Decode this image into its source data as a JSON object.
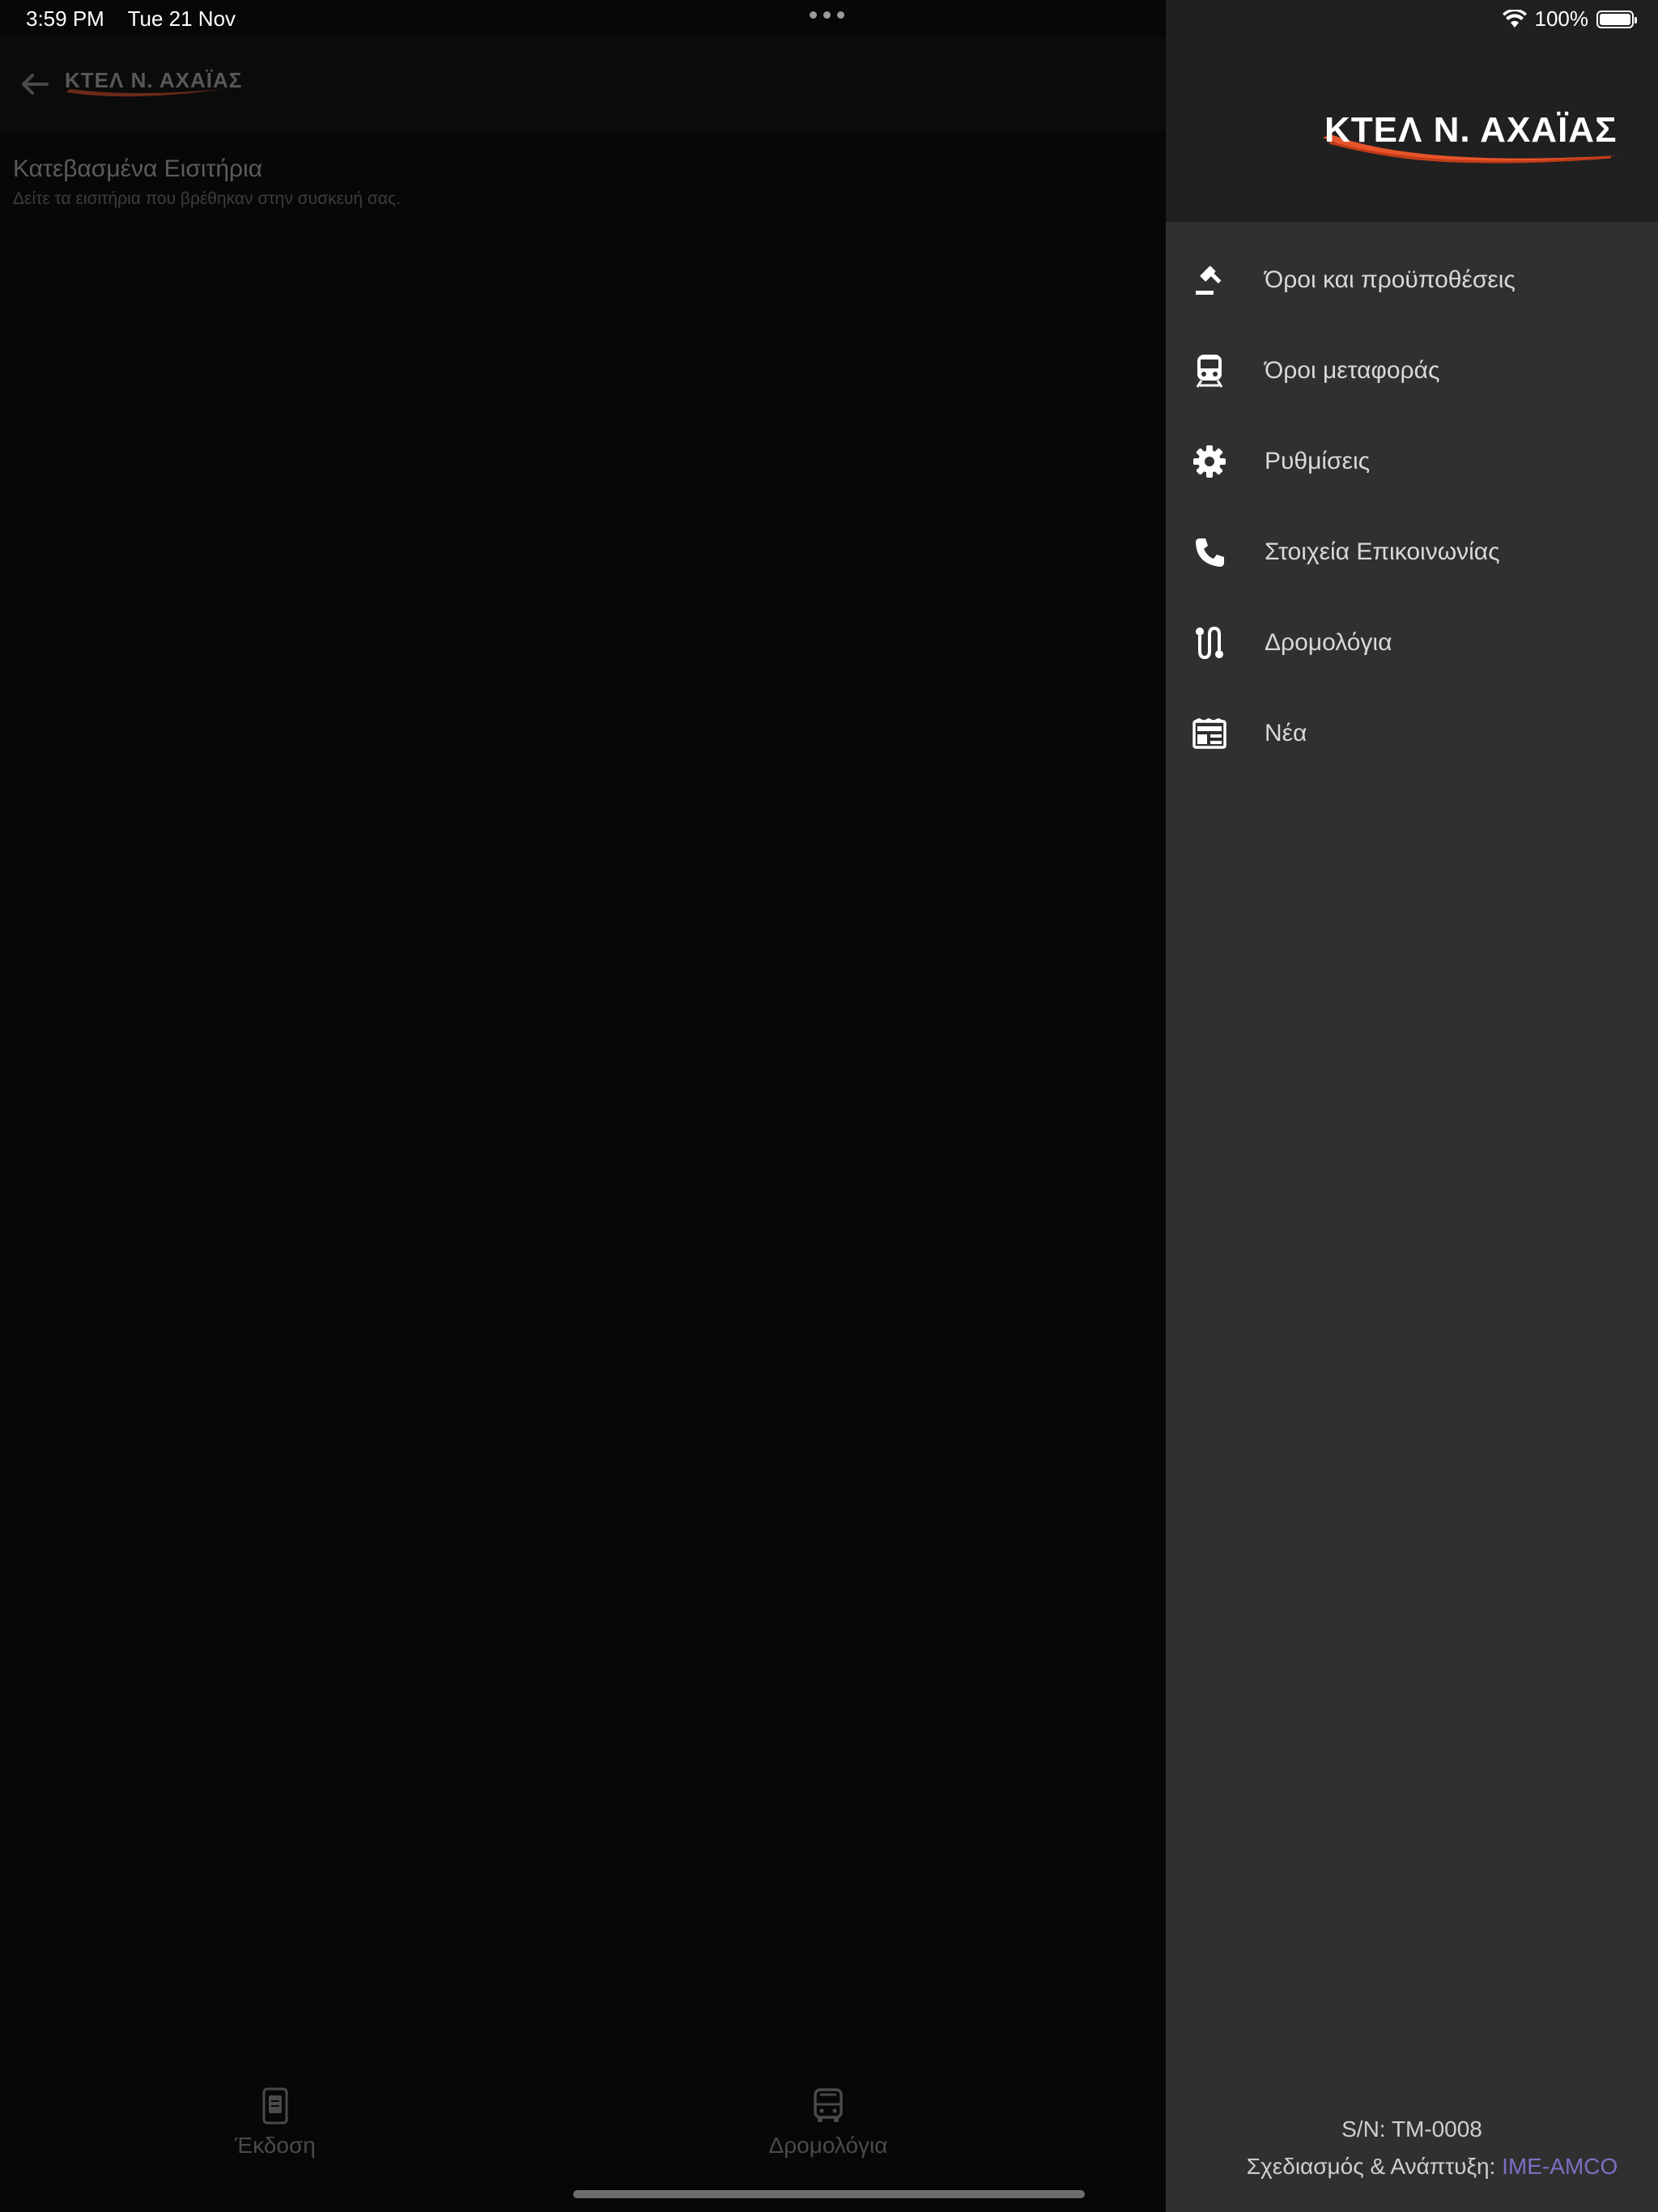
{
  "status_bar": {
    "time": "3:59 PM",
    "date": "Tue 21 Nov",
    "battery": "100%"
  },
  "brand": {
    "logo_text": "ΚΤΕΛ Ν. ΑΧΑΪΑΣ",
    "accent": "#e8542a"
  },
  "page": {
    "title": "Κατεβασμένα Εισιτήρια",
    "subtitle": "Δείτε τα εισιτήρια που βρέθηκαν στην συσκευή σας."
  },
  "bottom_nav": [
    {
      "label": "Έκδοση",
      "icon": "ticket-phone-icon"
    },
    {
      "label": "Δρομολόγια",
      "icon": "bus-icon"
    }
  ],
  "drawer": {
    "menu": [
      {
        "label": "Όροι και προϋποθέσεις",
        "icon": "gavel-icon"
      },
      {
        "label": "Όροι μεταφοράς",
        "icon": "train-icon"
      },
      {
        "label": "Ρυθμίσεις",
        "icon": "gear-icon"
      },
      {
        "label": "Στοιχεία Επικοινωνίας",
        "icon": "phone-icon"
      },
      {
        "label": "Δρομολόγια",
        "icon": "route-icon"
      },
      {
        "label": "Νέα",
        "icon": "news-icon"
      }
    ],
    "footer": {
      "serial": "S/N: TM-0008",
      "credit_prefix": "Σχεδιασμός & Ανάπτυξη:",
      "credit_brand": "IME-AMCO"
    }
  }
}
